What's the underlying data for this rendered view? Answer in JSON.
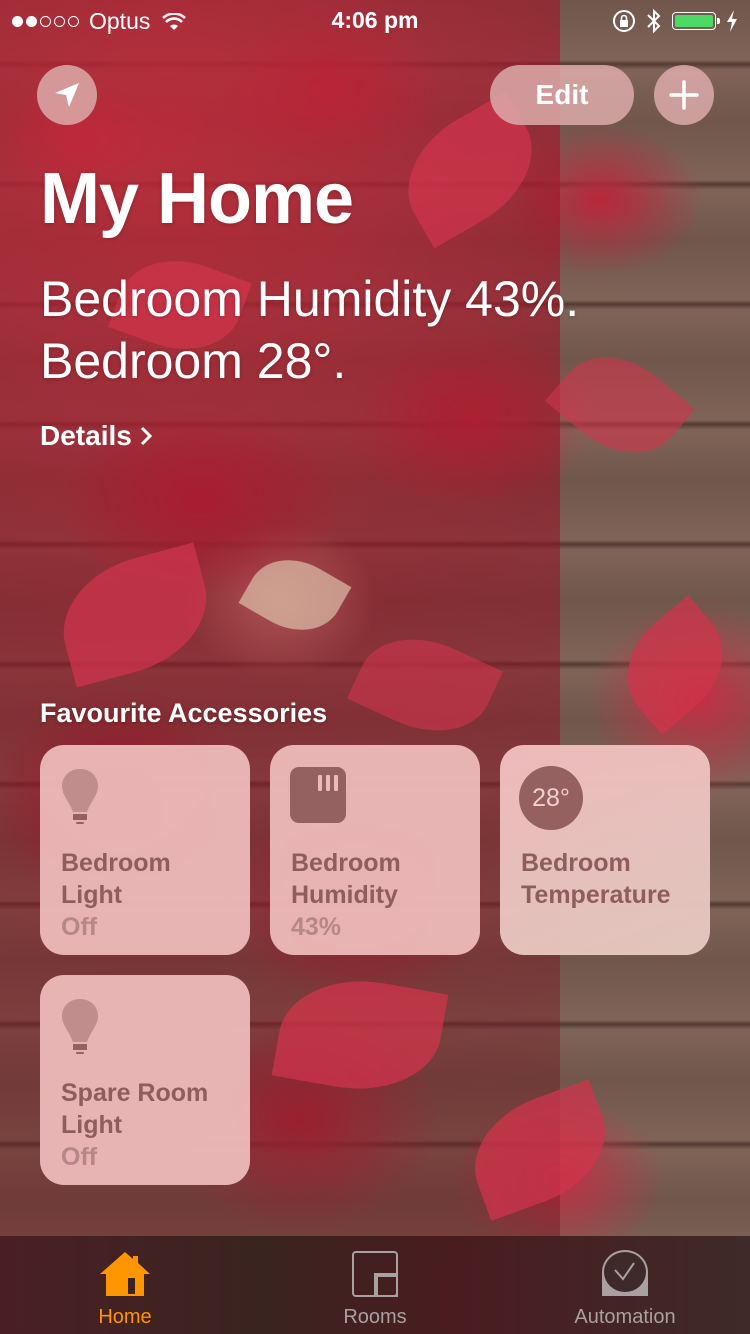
{
  "status_bar": {
    "signal_bars_filled": 2,
    "signal_bars_total": 5,
    "carrier": "Optus",
    "time": "4:06 pm",
    "battery_percent": 100,
    "charging": true
  },
  "header": {
    "location_button_icon": "location-arrow-icon",
    "edit_label": "Edit",
    "add_button_icon": "plus-icon"
  },
  "home": {
    "title": "My Home",
    "summary_line1": "Bedroom Humidity 43%.",
    "summary_line2": "Bedroom 28°.",
    "details_label": "Details"
  },
  "favourites": {
    "section_title": "Favourite Accessories",
    "tiles": [
      {
        "line1": "Bedroom",
        "line2": "Light",
        "state": "Off",
        "icon": "lightbulb-icon"
      },
      {
        "line1": "Bedroom",
        "line2": "Humidity",
        "state": "43%",
        "icon": "humidity-sensor-icon"
      },
      {
        "line1": "Bedroom",
        "line2": "Temperature",
        "badge": "28°",
        "icon": "temperature-badge"
      },
      {
        "line1": "Spare Room",
        "line2": "Light",
        "state": "Off",
        "icon": "lightbulb-icon"
      }
    ]
  },
  "tabbar": {
    "active_color": "#ff9500",
    "inactive_color": "#a9a0a0",
    "tabs": [
      {
        "label": "Home",
        "icon": "home-icon",
        "active": true
      },
      {
        "label": "Rooms",
        "icon": "rooms-icon",
        "active": false
      },
      {
        "label": "Automation",
        "icon": "automation-clock-icon",
        "active": false
      }
    ]
  }
}
